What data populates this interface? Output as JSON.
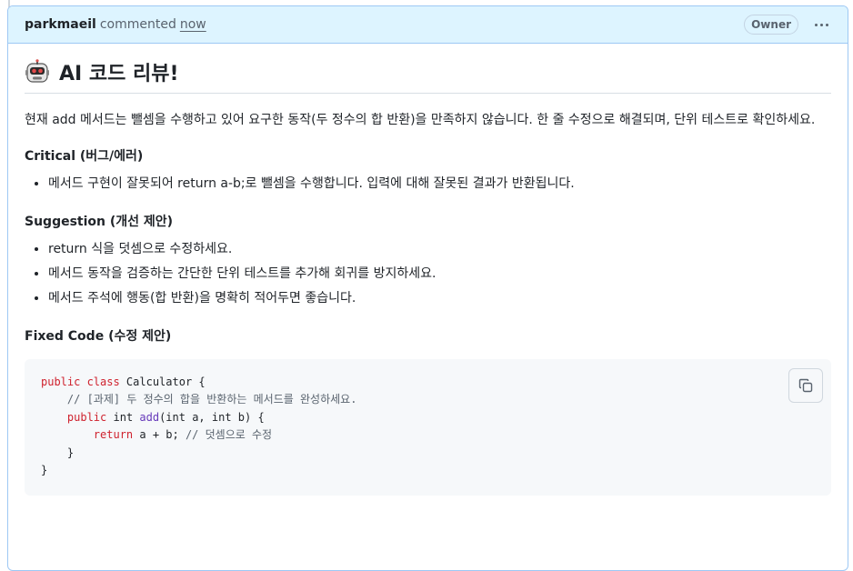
{
  "comment": {
    "author": "parkmaeil",
    "action": "commented",
    "time": "now",
    "badge": "Owner",
    "more_icon": "kebab-horizontal-icon"
  },
  "review": {
    "heading_icon": "robot-face-icon",
    "heading": "AI 코드 리뷰!",
    "intro": "현재 add 메서드는 뺄셈을 수행하고 있어 요구한 동작(두 정수의 합 반환)을 만족하지 않습니다. 한 줄 수정으로 해결되며, 단위 테스트로 확인하세요.",
    "sections": [
      {
        "title": "Critical (버그/에러)",
        "items": [
          "메서드 구현이 잘못되어 return a-b;로 뺄셈을 수행합니다. 입력에 대해 잘못된 결과가 반환됩니다."
        ]
      },
      {
        "title": "Suggestion (개선 제안)",
        "items": [
          "return 식을 덧셈으로 수정하세요.",
          "메서드 동작을 검증하는 간단한 단위 테스트를 추가해 회귀를 방지하세요.",
          "메서드 주석에 행동(합 반환)을 명확히 적어두면 좋습니다."
        ]
      }
    ],
    "fixed_code_title": "Fixed Code (수정 제안)",
    "code_lines": [
      [
        {
          "t": "public class",
          "c": "kw"
        },
        {
          "t": " Calculator {",
          "c": ""
        }
      ],
      [
        {
          "t": "    // [과제] 두 정수의 합을 반환하는 메서드를 완성하세요.",
          "c": "cm"
        }
      ],
      [
        {
          "t": "    ",
          "c": ""
        },
        {
          "t": "public",
          "c": "kw"
        },
        {
          "t": " int ",
          "c": ""
        },
        {
          "t": "add",
          "c": "fn"
        },
        {
          "t": "(int a, int b) {",
          "c": ""
        }
      ],
      [
        {
          "t": "        ",
          "c": ""
        },
        {
          "t": "return",
          "c": "kw"
        },
        {
          "t": " a + b; ",
          "c": ""
        },
        {
          "t": "// 덧셈으로 수정",
          "c": "cm"
        }
      ],
      [
        {
          "t": "    }",
          "c": ""
        }
      ],
      [
        {
          "t": "}",
          "c": ""
        }
      ]
    ],
    "copy_icon": "copy-icon"
  }
}
